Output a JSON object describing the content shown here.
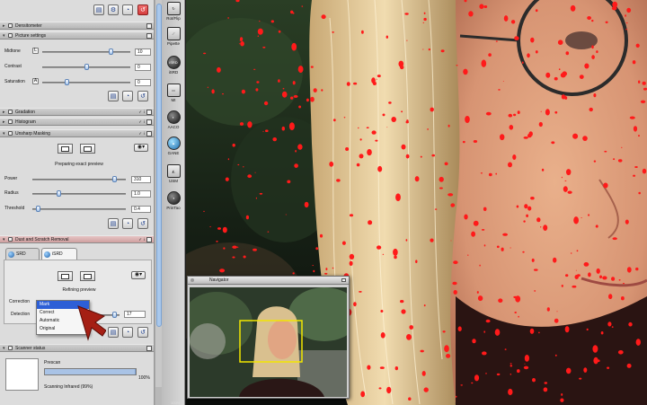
{
  "top_toolbar": {
    "buttons": [
      "save-settings",
      "settings",
      "preview",
      "reset"
    ]
  },
  "sections": {
    "densitometer": {
      "title": "Densitometer"
    },
    "picture_settings": {
      "title": "Picture settings",
      "rows": [
        {
          "label": "Midtone",
          "key": "L",
          "value": "10",
          "position": 0.78
        },
        {
          "label": "Contrast",
          "key": "",
          "value": "0",
          "position": 0.5
        },
        {
          "label": "Saturation",
          "key": "A",
          "value": "0",
          "position": 0.28
        }
      ]
    },
    "gradation": {
      "title": "Gradation"
    },
    "histogram": {
      "title": "Histogram"
    },
    "unsharp_masking": {
      "title": "Unsharp Masking",
      "preview_text": "Preparing exact preview",
      "rows": [
        {
          "label": "Power",
          "value": "310",
          "position": 0.88
        },
        {
          "label": "Radius",
          "value": "1.0",
          "position": 0.28
        },
        {
          "label": "Threshold",
          "value": "0.4",
          "position": 0.06
        }
      ]
    },
    "dust_scratch": {
      "title": "Dust and Scratch Removal",
      "tabs": [
        "SRD",
        "iSRD"
      ],
      "preview_text": "Refining preview",
      "correction_label": "Correction",
      "detection_label": "Detection",
      "detection_value": "17",
      "detection_position": 0.82,
      "dropdown_options": [
        "Mark",
        "Correct",
        "Automatic",
        "Original"
      ],
      "dropdown_selected": "Mark"
    },
    "scanner_status": {
      "title": "Scanner status",
      "prescan_label": "Prescan",
      "progress_percent": 100,
      "progress_text": "100%",
      "status_text": "Scanning Infrared (99%)"
    }
  },
  "tools": [
    {
      "label": "Rot/Flip",
      "style": "square"
    },
    {
      "label": "Pipette",
      "style": "square"
    },
    {
      "label": "iSRD",
      "style": "dark"
    },
    {
      "label": "MI",
      "style": "square"
    },
    {
      "label": "AACO",
      "style": "dark"
    },
    {
      "label": "GANE",
      "style": "blue"
    },
    {
      "label": "USM",
      "style": "square"
    },
    {
      "label": "PrinTao",
      "style": "dark"
    }
  ],
  "navigator": {
    "title": "Navigator"
  },
  "zoom_label": "100%",
  "colors": {
    "panel_bg": "#dcdcdc",
    "selection_blue": "#2d5fd6",
    "dust_mark_red": "#ff1a1a",
    "nav_frame_yellow": "#f2e600"
  }
}
